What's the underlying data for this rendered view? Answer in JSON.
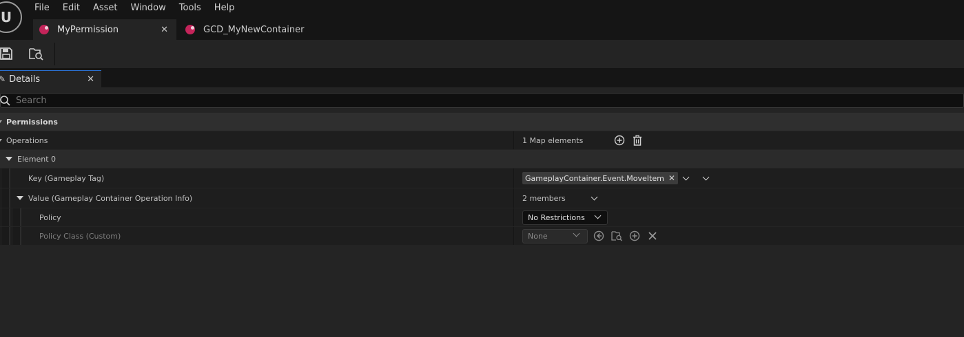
{
  "menu": [
    "File",
    "Edit",
    "Asset",
    "Window",
    "Tools",
    "Help"
  ],
  "tabs": [
    {
      "label": "MyPermission",
      "active": true
    },
    {
      "label": "GCD_MyNewContainer",
      "active": false
    }
  ],
  "tab_icon_color": "#c4245a",
  "panel": {
    "title": "Details"
  },
  "search": {
    "placeholder": "Search"
  },
  "category": "Permissions",
  "operations": {
    "label": "Operations",
    "summary": "1 Map elements"
  },
  "element": {
    "label": "Element 0"
  },
  "key": {
    "label": "Key (Gameplay Tag)",
    "tag": "GameplayContainer.Event.MoveItem"
  },
  "value": {
    "label": "Value (Gameplay Container Operation Info)",
    "summary": "2 members"
  },
  "policy": {
    "label": "Policy",
    "selected": "No Restrictions"
  },
  "policy_class": {
    "label": "Policy Class (Custom)",
    "selected": "None"
  },
  "accent": "#2a6fcf"
}
